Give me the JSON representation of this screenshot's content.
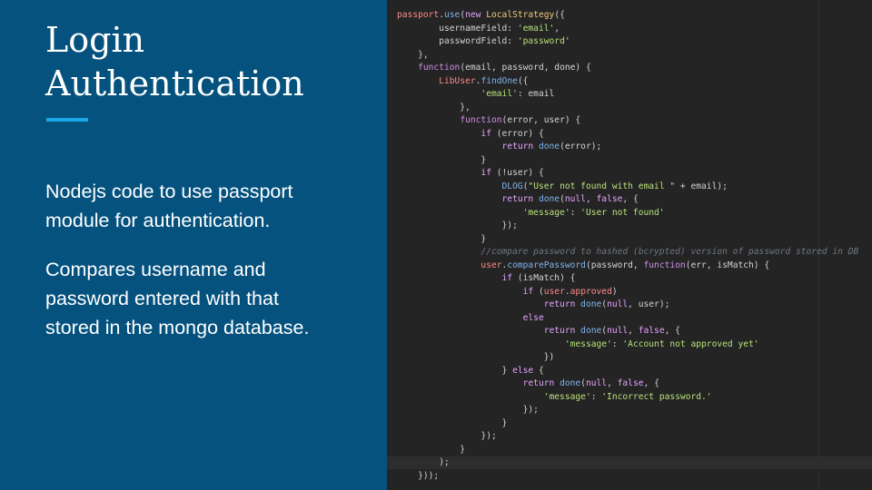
{
  "slide": {
    "title_lines": [
      "Login",
      "Authentication"
    ],
    "paragraph_1_lines": [
      "Nodejs code to use passport",
      "module for authentication."
    ],
    "paragraph_2_lines": [
      "Compares username and",
      "password entered with that",
      "stored in the mongo database."
    ]
  },
  "colors": {
    "background": "#05527e",
    "accent": "#1aa8e8",
    "code_background": "#242424"
  },
  "code": {
    "lines": [
      [
        {
          "t": "passport",
          "c": "obj"
        },
        {
          "t": ".",
          "c": "plain"
        },
        {
          "t": "use",
          "c": "func"
        },
        {
          "t": "(",
          "c": "plain"
        },
        {
          "t": "new",
          "c": "keyword"
        },
        {
          "t": " ",
          "c": "plain"
        },
        {
          "t": "LocalStrategy",
          "c": "builtin"
        },
        {
          "t": "({",
          "c": "plain"
        }
      ],
      [
        {
          "t": "        usernameField: ",
          "c": "plain"
        },
        {
          "t": "'email'",
          "c": "string"
        },
        {
          "t": ",",
          "c": "plain"
        }
      ],
      [
        {
          "t": "        passwordField: ",
          "c": "plain"
        },
        {
          "t": "'password'",
          "c": "string"
        }
      ],
      [
        {
          "t": "    },",
          "c": "plain"
        }
      ],
      [
        {
          "t": "    ",
          "c": "plain"
        },
        {
          "t": "function",
          "c": "keyword2"
        },
        {
          "t": "(email, password, done) {",
          "c": "plain"
        }
      ],
      [
        {
          "t": "        ",
          "c": "plain"
        },
        {
          "t": "LibUser",
          "c": "obj"
        },
        {
          "t": ".",
          "c": "plain"
        },
        {
          "t": "findOne",
          "c": "func"
        },
        {
          "t": "({",
          "c": "plain"
        }
      ],
      [
        {
          "t": "                ",
          "c": "plain"
        },
        {
          "t": "'email'",
          "c": "string"
        },
        {
          "t": ": email",
          "c": "plain"
        }
      ],
      [
        {
          "t": "            },",
          "c": "plain"
        }
      ],
      [
        {
          "t": "            ",
          "c": "plain"
        },
        {
          "t": "function",
          "c": "keyword2"
        },
        {
          "t": "(error, user) {",
          "c": "plain"
        }
      ],
      [
        {
          "t": "                ",
          "c": "plain"
        },
        {
          "t": "if",
          "c": "keyword"
        },
        {
          "t": " (error) {",
          "c": "plain"
        }
      ],
      [
        {
          "t": "                    ",
          "c": "plain"
        },
        {
          "t": "return",
          "c": "keyword"
        },
        {
          "t": " ",
          "c": "plain"
        },
        {
          "t": "done",
          "c": "func"
        },
        {
          "t": "(error);",
          "c": "plain"
        }
      ],
      [
        {
          "t": "                }",
          "c": "plain"
        }
      ],
      [
        {
          "t": "                ",
          "c": "plain"
        },
        {
          "t": "if",
          "c": "keyword"
        },
        {
          "t": " (!user) {",
          "c": "plain"
        }
      ],
      [
        {
          "t": "                    ",
          "c": "plain"
        },
        {
          "t": "DLOG",
          "c": "func"
        },
        {
          "t": "(",
          "c": "plain"
        },
        {
          "t": "\"User not found with email \"",
          "c": "string"
        },
        {
          "t": " + email);",
          "c": "plain"
        }
      ],
      [
        {
          "t": "                    ",
          "c": "plain"
        },
        {
          "t": "return",
          "c": "keyword"
        },
        {
          "t": " ",
          "c": "plain"
        },
        {
          "t": "done",
          "c": "func"
        },
        {
          "t": "(",
          "c": "plain"
        },
        {
          "t": "null",
          "c": "keyword"
        },
        {
          "t": ", ",
          "c": "plain"
        },
        {
          "t": "false",
          "c": "keyword"
        },
        {
          "t": ", {",
          "c": "plain"
        }
      ],
      [
        {
          "t": "                        ",
          "c": "plain"
        },
        {
          "t": "'message'",
          "c": "string"
        },
        {
          "t": ": ",
          "c": "plain"
        },
        {
          "t": "'User not found'",
          "c": "string"
        }
      ],
      [
        {
          "t": "                    });",
          "c": "plain"
        }
      ],
      [
        {
          "t": "                }",
          "c": "plain"
        }
      ],
      [
        {
          "t": "                ",
          "c": "plain"
        },
        {
          "t": "//compare password to hashed (bcrypted) version of password stored in DB",
          "c": "comment"
        }
      ],
      [
        {
          "t": "                ",
          "c": "plain"
        },
        {
          "t": "user",
          "c": "obj"
        },
        {
          "t": ".",
          "c": "plain"
        },
        {
          "t": "comparePassword",
          "c": "func"
        },
        {
          "t": "(password, ",
          "c": "plain"
        },
        {
          "t": "function",
          "c": "keyword2"
        },
        {
          "t": "(err, isMatch) {",
          "c": "plain"
        }
      ],
      [
        {
          "t": "                    ",
          "c": "plain"
        },
        {
          "t": "if",
          "c": "keyword"
        },
        {
          "t": " (isMatch) {",
          "c": "plain"
        }
      ],
      [
        {
          "t": "                        ",
          "c": "plain"
        },
        {
          "t": "if",
          "c": "keyword"
        },
        {
          "t": " (",
          "c": "plain"
        },
        {
          "t": "user",
          "c": "obj"
        },
        {
          "t": ".",
          "c": "plain"
        },
        {
          "t": "approved",
          "c": "obj"
        },
        {
          "t": ")",
          "c": "plain"
        }
      ],
      [
        {
          "t": "                            ",
          "c": "plain"
        },
        {
          "t": "return",
          "c": "keyword"
        },
        {
          "t": " ",
          "c": "plain"
        },
        {
          "t": "done",
          "c": "func"
        },
        {
          "t": "(",
          "c": "plain"
        },
        {
          "t": "null",
          "c": "keyword"
        },
        {
          "t": ", user);",
          "c": "plain"
        }
      ],
      [
        {
          "t": "                        ",
          "c": "plain"
        },
        {
          "t": "else",
          "c": "keyword"
        }
      ],
      [
        {
          "t": "                            ",
          "c": "plain"
        },
        {
          "t": "return",
          "c": "keyword"
        },
        {
          "t": " ",
          "c": "plain"
        },
        {
          "t": "done",
          "c": "func"
        },
        {
          "t": "(",
          "c": "plain"
        },
        {
          "t": "null",
          "c": "keyword"
        },
        {
          "t": ", ",
          "c": "plain"
        },
        {
          "t": "false",
          "c": "keyword"
        },
        {
          "t": ", {",
          "c": "plain"
        }
      ],
      [
        {
          "t": "                                ",
          "c": "plain"
        },
        {
          "t": "'message'",
          "c": "string"
        },
        {
          "t": ": ",
          "c": "plain"
        },
        {
          "t": "'Account not approved yet'",
          "c": "string"
        }
      ],
      [
        {
          "t": "                            })",
          "c": "plain"
        }
      ],
      [
        {
          "t": "                    } ",
          "c": "plain"
        },
        {
          "t": "else",
          "c": "keyword"
        },
        {
          "t": " {",
          "c": "plain"
        }
      ],
      [
        {
          "t": "                        ",
          "c": "plain"
        },
        {
          "t": "return",
          "c": "keyword"
        },
        {
          "t": " ",
          "c": "plain"
        },
        {
          "t": "done",
          "c": "func"
        },
        {
          "t": "(",
          "c": "plain"
        },
        {
          "t": "null",
          "c": "keyword"
        },
        {
          "t": ", ",
          "c": "plain"
        },
        {
          "t": "false",
          "c": "keyword"
        },
        {
          "t": ", {",
          "c": "plain"
        }
      ],
      [
        {
          "t": "                            ",
          "c": "plain"
        },
        {
          "t": "'message'",
          "c": "string"
        },
        {
          "t": ": ",
          "c": "plain"
        },
        {
          "t": "'Incorrect password.'",
          "c": "string"
        }
      ],
      [
        {
          "t": "                        });",
          "c": "plain"
        }
      ],
      [
        {
          "t": "                    }",
          "c": "plain"
        }
      ],
      [
        {
          "t": "                });",
          "c": "plain"
        }
      ],
      [
        {
          "t": "            }",
          "c": "plain"
        }
      ],
      [
        {
          "t": "        );",
          "c": "plain"
        }
      ],
      [
        {
          "t": "    }));",
          "c": "plain"
        }
      ]
    ]
  }
}
